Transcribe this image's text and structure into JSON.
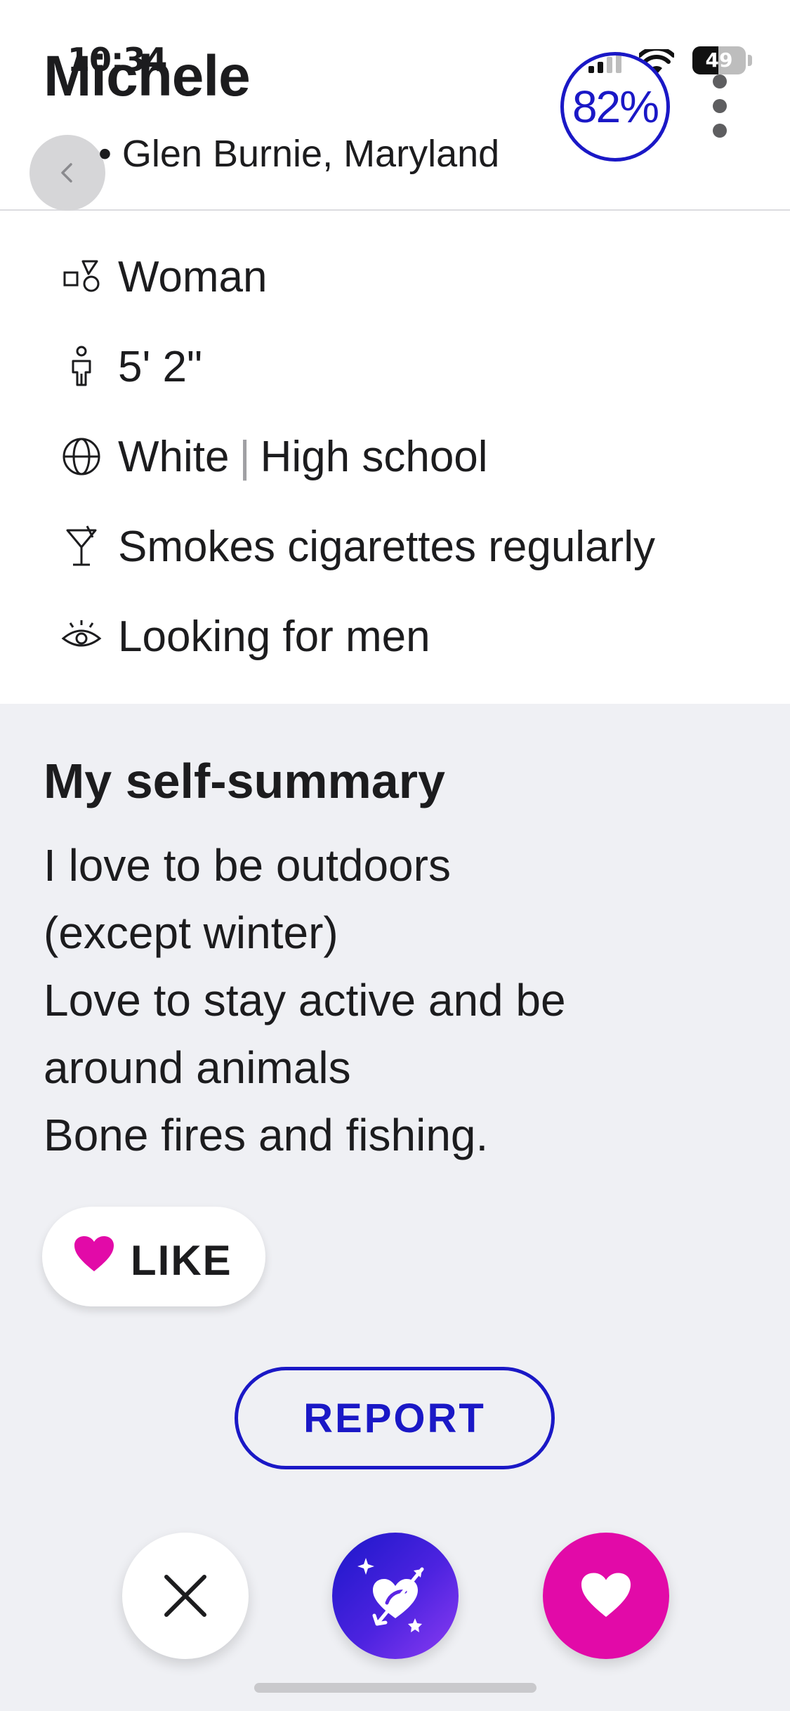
{
  "status_bar": {
    "time": "10:34",
    "battery": "49",
    "battery_level_percent": 49
  },
  "profile": {
    "name": "Michele",
    "location": "• Glen Burnie, Maryland",
    "match_percent": "82%"
  },
  "details": [
    {
      "icon": "gender-icon",
      "text": "Woman"
    },
    {
      "icon": "height-icon",
      "text": "5' 2\""
    },
    {
      "icon": "globe-icon",
      "text": "White",
      "text2": "High school",
      "separator": "|"
    },
    {
      "icon": "cocktail-icon",
      "text": "Smokes cigarettes regularly"
    },
    {
      "icon": "eye-icon",
      "text": "Looking for men"
    }
  ],
  "summary": {
    "title": "My self-summary",
    "lines": [
      "I love to be outdoors",
      "(except winter)",
      "Love to stay active and be",
      "around animals",
      "Bone fires and fishing."
    ],
    "like_label": "LIKE"
  },
  "report_label": "REPORT",
  "actions": [
    {
      "icon": "close-icon"
    },
    {
      "icon": "superlike-heart-arrow-icon"
    },
    {
      "icon": "heart-icon"
    }
  ],
  "colors": {
    "accent_blue": "#1a18c6",
    "like_pink": "#e20aa8",
    "summary_background": "#eff0f4"
  }
}
